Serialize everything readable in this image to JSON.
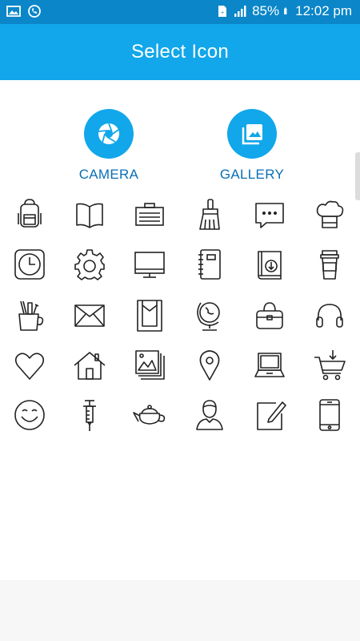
{
  "status_bar": {
    "battery": "85%",
    "time": "12:02 pm"
  },
  "app_bar": {
    "title": "Select Icon"
  },
  "sources": {
    "camera_label": "CAMERA",
    "gallery_label": "GALLERY"
  },
  "icons": [
    "backpack-icon",
    "open-book-icon",
    "briefcase-icon",
    "broom-icon",
    "chat-bubble-icon",
    "chef-hat-icon",
    "clock-icon",
    "gear-icon",
    "monitor-icon",
    "notebook-icon",
    "download-book-icon",
    "coffee-cup-icon",
    "pencil-cup-icon",
    "envelope-icon",
    "door-icon",
    "globe-icon",
    "handbag-icon",
    "headphones-icon",
    "heart-icon",
    "house-icon",
    "photos-icon",
    "map-pin-icon",
    "laptop-icon",
    "shopping-cart-icon",
    "smiley-icon",
    "syringe-icon",
    "teapot-icon",
    "person-icon",
    "note-pencil-icon",
    "smartphone-icon"
  ]
}
